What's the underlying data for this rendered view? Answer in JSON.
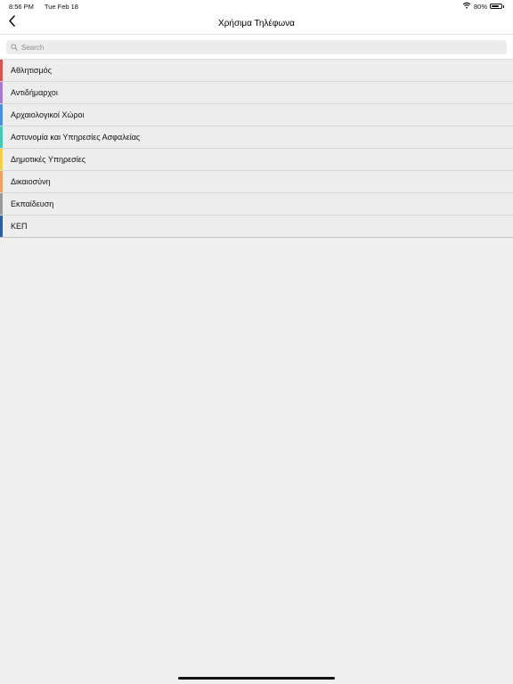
{
  "status": {
    "time": "8:56 PM",
    "date": "Tue Feb 18",
    "battery": "80%",
    "battery_level": 0.8,
    "wifi_icon": "wifi-icon"
  },
  "nav": {
    "title": "Χρήσιμα Τηλέφωνα",
    "back_icon": "chevron-left-icon"
  },
  "search": {
    "placeholder": "Search",
    "value": ""
  },
  "categories": [
    {
      "label": "Αθλητισμός",
      "color": "#d9534f"
    },
    {
      "label": "Αντιδήμαρχοι",
      "color": "#a77bd4"
    },
    {
      "label": "Αρχαιολογικοί Χώροι",
      "color": "#4f8fe0"
    },
    {
      "label": "Αστυνομία και Υπηρεσίες Ασφαλείας",
      "color": "#45c9b4"
    },
    {
      "label": "Δημοτικές Υπηρεσίες",
      "color": "#f2d14a"
    },
    {
      "label": "Δικαιοσύνη",
      "color": "#f0a060"
    },
    {
      "label": "Εκπαίδευση",
      "color": "#9a9a9a"
    },
    {
      "label": "ΚΕΠ",
      "color": "#2b5f9e"
    }
  ]
}
